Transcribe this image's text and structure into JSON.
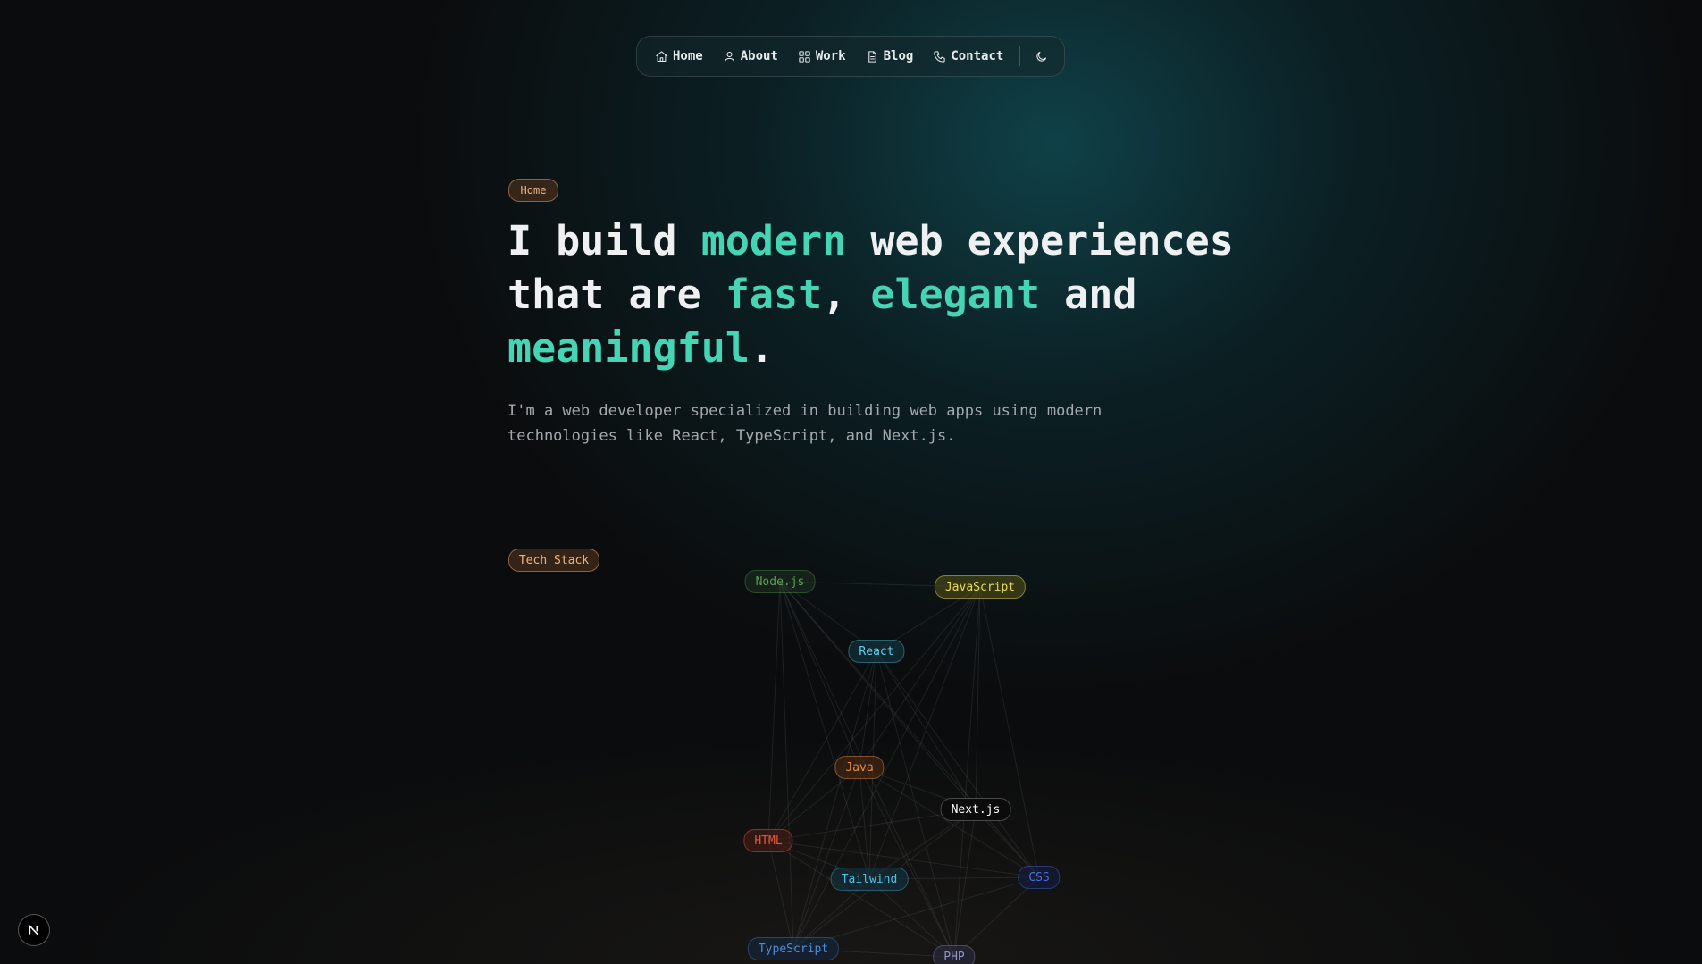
{
  "nav": {
    "items": [
      {
        "label": "Home",
        "icon": "home-icon"
      },
      {
        "label": "About",
        "icon": "user-icon"
      },
      {
        "label": "Work",
        "icon": "grid-icon"
      },
      {
        "label": "Blog",
        "icon": "document-icon"
      },
      {
        "label": "Contact",
        "icon": "phone-icon"
      }
    ],
    "theme_toggle_icon": "moon-icon"
  },
  "hero": {
    "badge": "Home",
    "headline": {
      "p1": "I build ",
      "h1": "modern",
      "p2": " web experiences that are ",
      "h2": "fast",
      "p3": ", ",
      "h3": "elegant",
      "p4": " and ",
      "h4": "meaningful",
      "p5": "."
    },
    "subtext": "I'm a web developer specialized in building web apps using modern technologies like React, TypeScript, and Next.js."
  },
  "tech_stack": {
    "badge": "Tech Stack",
    "chips": [
      {
        "label": "Node.js",
        "color": "#5aa05a",
        "bg": "rgba(40,70,40,0.35)",
        "border": "rgba(90,160,90,0.35)"
      },
      {
        "label": "JavaScript",
        "color": "#e8dc55",
        "bg": "rgba(90,85,20,0.55)",
        "border": "rgba(232,220,85,0.45)"
      },
      {
        "label": "React",
        "color": "#5fd0ec",
        "bg": "rgba(20,60,75,0.55)",
        "border": "rgba(95,208,236,0.35)"
      },
      {
        "label": "Java",
        "color": "#e88a3a",
        "bg": "rgba(80,45,20,0.55)",
        "border": "rgba(232,138,58,0.45)"
      },
      {
        "label": "Next.js",
        "color": "#ffffff",
        "bg": "rgba(10,10,10,0.85)",
        "border": "rgba(255,255,255,0.25)"
      },
      {
        "label": "HTML",
        "color": "#e3543a",
        "bg": "rgba(80,30,20,0.55)",
        "border": "rgba(227,84,58,0.45)"
      },
      {
        "label": "Tailwind",
        "color": "#4dc0e8",
        "bg": "rgba(20,55,70,0.55)",
        "border": "rgba(77,192,232,0.35)"
      },
      {
        "label": "CSS",
        "color": "#4a6fe0",
        "bg": "rgba(20,30,70,0.55)",
        "border": "rgba(74,111,224,0.4)"
      },
      {
        "label": "TypeScript",
        "color": "#4b8fd8",
        "bg": "rgba(20,40,70,0.55)",
        "border": "rgba(75,143,216,0.35)"
      },
      {
        "label": "PHP",
        "color": "#8f93c8",
        "bg": "rgba(45,45,70,0.55)",
        "border": "rgba(143,147,200,0.35)"
      }
    ]
  },
  "next_badge_icon": "nextjs-logo-icon"
}
